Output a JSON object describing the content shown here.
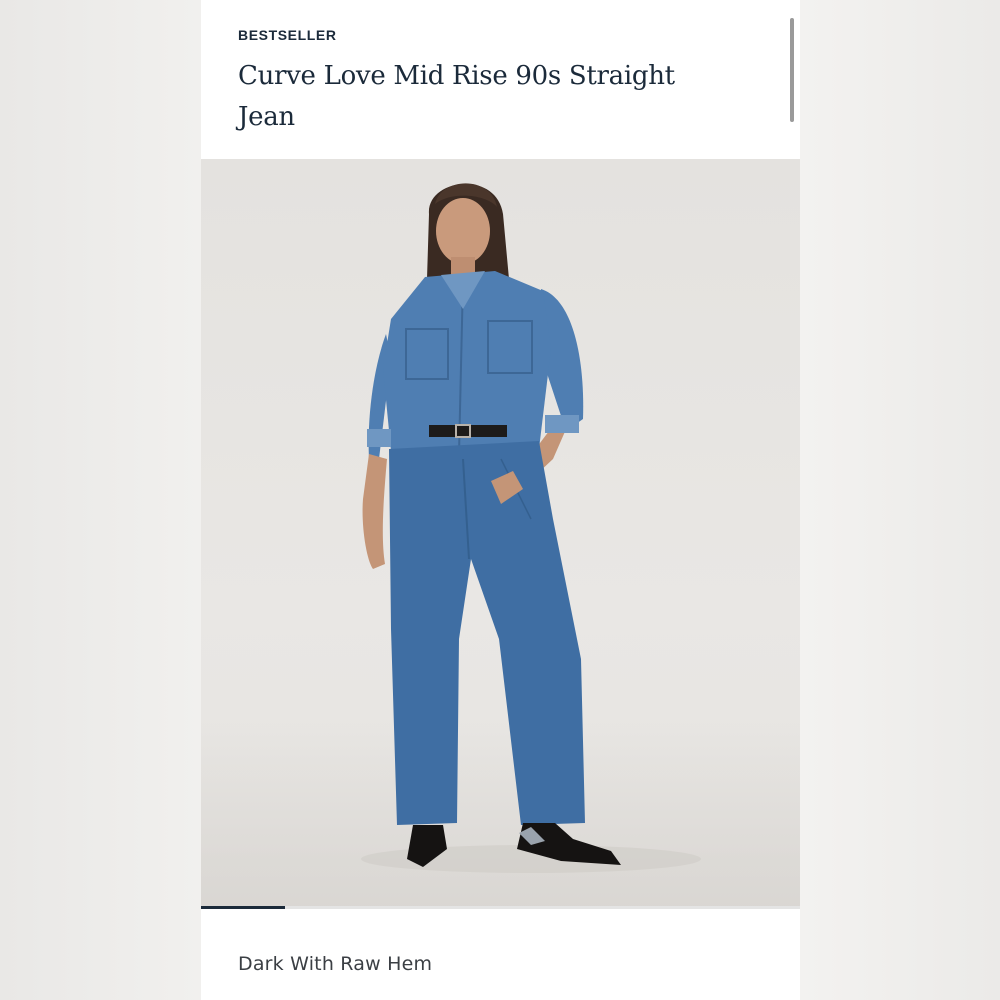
{
  "product": {
    "badge": "BESTSELLER",
    "title": "Curve Love Mid Rise 90s Straight Jean"
  },
  "gallery": {
    "progress": 0.14
  },
  "variant": {
    "wash_label": "Dark With Raw Hem"
  },
  "colors": {
    "text_primary": "#1b2a3a",
    "denim_shirt": "#4f7eb2",
    "denim_jean": "#3f6ea3"
  },
  "icons": {
    "scrollbar": "vertical-scroll-indicator"
  }
}
